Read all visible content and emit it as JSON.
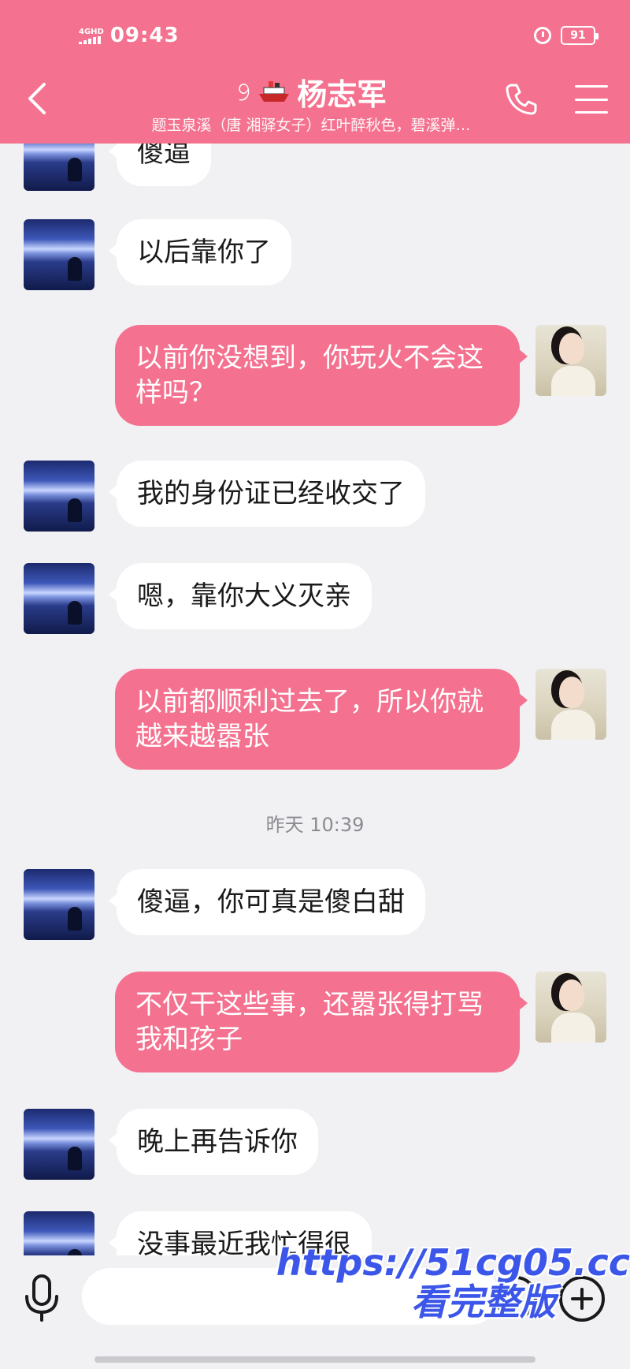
{
  "status_bar": {
    "network": "4GHD",
    "time": "09:43",
    "battery": "91"
  },
  "header": {
    "title": "杨志军",
    "subtitle": "题玉泉溪（唐 湘驿女子）红叶醉秋色，碧溪弹…",
    "colors": {
      "accent": "#f4728f"
    }
  },
  "messages": [
    {
      "side": "in",
      "text": "傻逼"
    },
    {
      "side": "in",
      "text": "以后靠你了"
    },
    {
      "side": "out",
      "text": "以前你没想到，你玩火不会这样吗？"
    },
    {
      "side": "in",
      "text": "我的身份证已经收交了"
    },
    {
      "side": "in",
      "text": "嗯，靠你大义灭亲"
    },
    {
      "side": "out",
      "text": "以前都顺利过去了，所以你就越来越嚣张"
    },
    {
      "side": "time",
      "text": "昨天 10:39"
    },
    {
      "side": "in",
      "text": "傻逼，你可真是傻白甜"
    },
    {
      "side": "out",
      "text": "不仅干这些事，还嚣张得打骂我和孩子"
    },
    {
      "side": "in",
      "text": "晚上再告诉你"
    },
    {
      "side": "in",
      "text": "没事最近我忙得很"
    }
  ],
  "watermark": {
    "url": "https://51cg05.cc",
    "caption": "看完整版"
  }
}
